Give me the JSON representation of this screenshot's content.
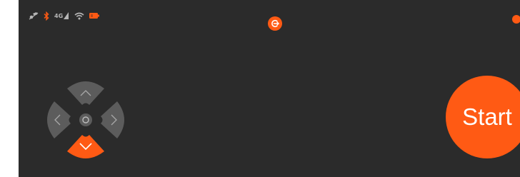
{
  "status_bar": {
    "icons": [
      "no-location-icon",
      "bluetooth-icon",
      "signal-4g-icon",
      "wifi-icon",
      "battery-icon"
    ],
    "network_label": "4G"
  },
  "colors": {
    "accent": "#ff5a14",
    "background": "#2b2b2b",
    "dpad_idle": "#5c5c5c",
    "icon_gray": "#b5b5b5"
  },
  "controls": {
    "exit_icon": "exit-icon",
    "start_label": "Start",
    "dpad": {
      "active_direction": "down",
      "directions": [
        "up",
        "left",
        "right",
        "down"
      ]
    }
  }
}
